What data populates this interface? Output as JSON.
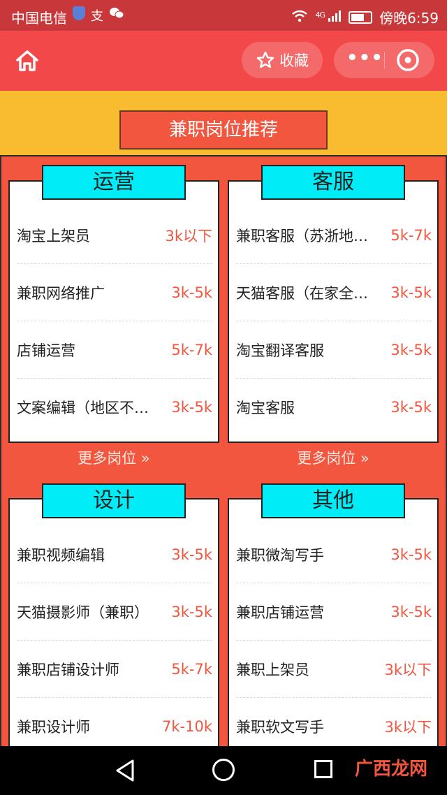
{
  "status_bar": {
    "carrier": "中国电信",
    "app_icon_text": "支",
    "network": "4G",
    "time": "傍晚6:59"
  },
  "nav_bar": {
    "favorite_label": "收藏",
    "more_label": "•••"
  },
  "section_title": "兼职岗位推荐",
  "categories": [
    {
      "title": "运营",
      "rows": [
        {
          "job": "淘宝上架员",
          "pay": "3k以下"
        },
        {
          "job": "兼职网络推广",
          "pay": "3k-5k"
        },
        {
          "job": "店铺运营",
          "pay": "5k-7k"
        },
        {
          "job": "文案编辑（地区不限）",
          "pay": "3k-5k"
        }
      ],
      "more": "更多岗位 »"
    },
    {
      "title": "客服",
      "rows": [
        {
          "job": "兼职客服（苏浙地区）",
          "pay": "5k-7k"
        },
        {
          "job": "天猫客服（在家全职）",
          "pay": "3k-5k"
        },
        {
          "job": "淘宝翻译客服",
          "pay": "3k-5k"
        },
        {
          "job": "淘宝客服",
          "pay": "3k-5k"
        }
      ],
      "more": "更多岗位 »"
    },
    {
      "title": "设计",
      "rows": [
        {
          "job": "兼职视频编辑",
          "pay": "3k-5k"
        },
        {
          "job": "天猫摄影师（兼职）",
          "pay": "3k-5k"
        },
        {
          "job": "兼职店铺设计师",
          "pay": "5k-7k"
        },
        {
          "job": "兼职设计师",
          "pay": "7k-10k"
        }
      ]
    },
    {
      "title": "其他",
      "rows": [
        {
          "job": "兼职微淘写手",
          "pay": "3k-5k"
        },
        {
          "job": "兼职店铺运营",
          "pay": "3k-5k"
        },
        {
          "job": "兼职上架员",
          "pay": "3k以下"
        },
        {
          "job": "兼职软文写手",
          "pay": "3k以下"
        }
      ]
    }
  ],
  "watermark": "广西龙网",
  "colors": {
    "accent": "#f2563f",
    "nav": "#f2484a",
    "header_strip": "#f9bb30",
    "card_title_bg": "#00ecf6"
  }
}
